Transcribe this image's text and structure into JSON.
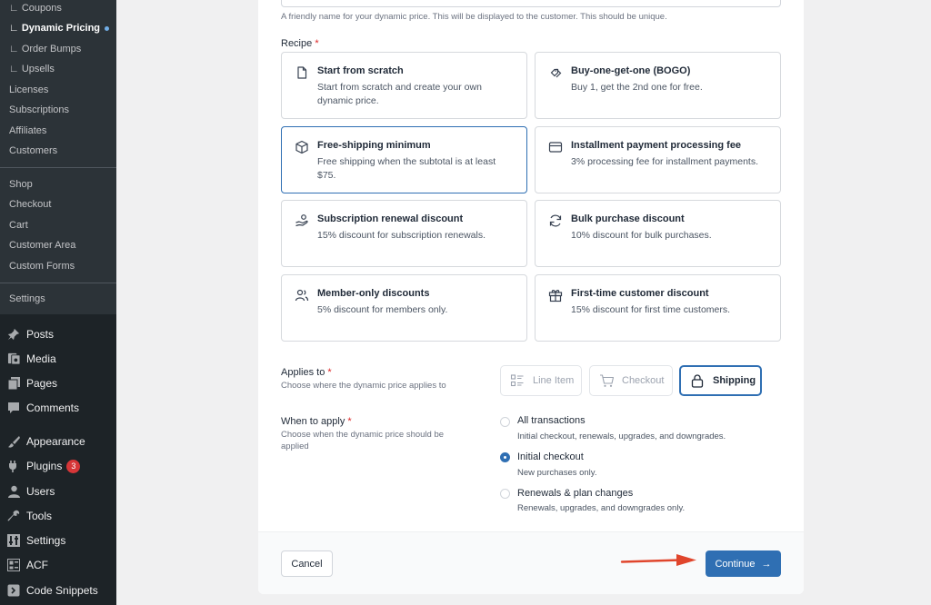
{
  "sidebar": {
    "submenu": [
      {
        "label": "∟ Coupons"
      },
      {
        "label": "∟ Dynamic Pricing"
      },
      {
        "label": "∟ Order Bumps"
      },
      {
        "label": "∟ Upsells"
      },
      {
        "label": "Licenses"
      },
      {
        "label": "Subscriptions"
      },
      {
        "label": "Affiliates"
      },
      {
        "label": "Customers"
      },
      {
        "label": "Shop"
      },
      {
        "label": "Checkout"
      },
      {
        "label": "Cart"
      },
      {
        "label": "Customer Area"
      },
      {
        "label": "Custom Forms"
      },
      {
        "label": "Settings"
      }
    ],
    "menu": [
      {
        "label": "Posts",
        "icon": "pushpin-icon"
      },
      {
        "label": "Media",
        "icon": "media-icon"
      },
      {
        "label": "Pages",
        "icon": "pages-icon"
      },
      {
        "label": "Comments",
        "icon": "comment-icon"
      },
      {
        "label": "Appearance",
        "icon": "paintbrush-icon"
      },
      {
        "label": "Plugins",
        "icon": "plugin-icon",
        "badge": "3"
      },
      {
        "label": "Users",
        "icon": "user-icon"
      },
      {
        "label": "Tools",
        "icon": "wrench-icon"
      },
      {
        "label": "Settings",
        "icon": "settings-icon"
      },
      {
        "label": "ACF",
        "icon": "acf-icon"
      },
      {
        "label": "Code Snippets",
        "icon": "code-snippets-icon"
      }
    ]
  },
  "form": {
    "name_hint": "A friendly name for your dynamic price. This will be displayed to the customer. This should be unique.",
    "recipe_label": "Recipe",
    "required_mark": "*",
    "recipes": [
      {
        "title": "Start from scratch",
        "desc": "Start from scratch and create your own dynamic price.",
        "icon": "file-icon"
      },
      {
        "title": "Buy-one-get-one (BOGO)",
        "desc": "Buy 1, get the 2nd one for free.",
        "icon": "tags-icon"
      },
      {
        "title": "Free-shipping minimum",
        "desc": "Free shipping when the subtotal is at least $75.",
        "icon": "package-icon",
        "selected": true
      },
      {
        "title": "Installment payment processing fee",
        "desc": "3% processing fee for installment payments.",
        "icon": "credit-card-icon"
      },
      {
        "title": "Subscription renewal discount",
        "desc": "15% discount for subscription renewals.",
        "icon": "hand-coins-icon"
      },
      {
        "title": "Bulk purchase discount",
        "desc": "10% discount for bulk purchases.",
        "icon": "refresh-icon"
      },
      {
        "title": "Member-only discounts",
        "desc": "5% discount for members only.",
        "icon": "users-icon"
      },
      {
        "title": "First-time customer discount",
        "desc": "15% discount for first time customers.",
        "icon": "gift-icon"
      }
    ],
    "applies_to": {
      "label": "Applies to",
      "help": "Choose where the dynamic price applies to",
      "options": [
        {
          "label": "Line Item",
          "icon": "list-icon"
        },
        {
          "label": "Checkout",
          "icon": "cart-icon"
        },
        {
          "label": "Shipping",
          "icon": "lock-icon",
          "selected": true
        }
      ]
    },
    "when_to_apply": {
      "label": "When to apply",
      "help": "Choose when the dynamic price should be applied",
      "options": [
        {
          "title": "All transactions",
          "desc": "Initial checkout, renewals, upgrades, and downgrades."
        },
        {
          "title": "Initial checkout",
          "desc": "New purchases only.",
          "checked": true
        },
        {
          "title": "Renewals & plan changes",
          "desc": "Renewals, upgrades, and downgrades only."
        }
      ]
    }
  },
  "footer": {
    "cancel_label": "Cancel",
    "continue_label": "Continue",
    "continue_icon": "arrow-right-icon"
  },
  "colors": {
    "accent": "#2f6fb3",
    "sidebar_bg": "#1d2327",
    "submenu_bg": "#2c3338",
    "annotation_arrow": "#e0452c",
    "badge": "#d63638"
  }
}
